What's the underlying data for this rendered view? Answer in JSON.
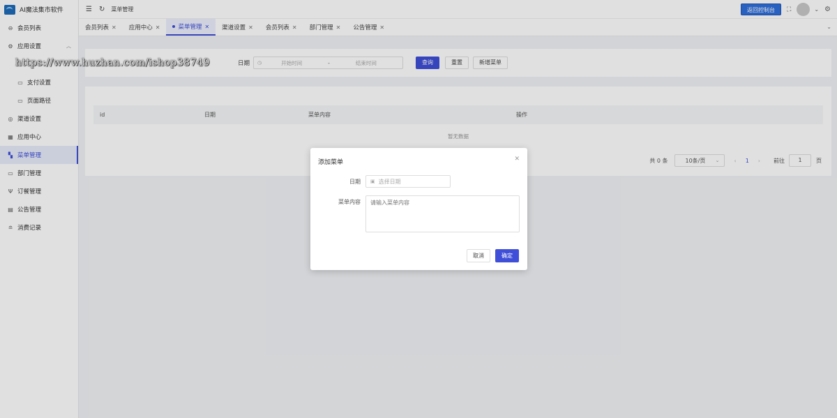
{
  "app": {
    "name": "AI魔法集市软件",
    "accent": "#3f4fd8"
  },
  "sidebar": {
    "items": [
      {
        "label": "会员列表",
        "icon": "user-circle-icon"
      },
      {
        "label": "应用设置",
        "icon": "gear-icon",
        "expanded": true
      },
      {
        "label": "支付设置",
        "icon": "folder-icon"
      },
      {
        "label": "页面路径",
        "icon": "folder-icon"
      },
      {
        "label": "渠道设置",
        "icon": "compass-icon"
      },
      {
        "label": "应用中心",
        "icon": "grid-icon"
      },
      {
        "label": "菜单管理",
        "icon": "grid-icon",
        "active": true
      },
      {
        "label": "部门管理",
        "icon": "folder-icon"
      },
      {
        "label": "订餐管理",
        "icon": "fork-knife-icon"
      },
      {
        "label": "公告管理",
        "icon": "document-icon"
      },
      {
        "label": "消费记录",
        "icon": "database-icon"
      }
    ]
  },
  "header": {
    "breadcrumb": "菜单管理",
    "console_button": "返回控制台"
  },
  "tabs": [
    {
      "label": "会员列表"
    },
    {
      "label": "应用中心"
    },
    {
      "label": "菜单管理",
      "active": true
    },
    {
      "label": "渠道设置"
    },
    {
      "label": "会员列表"
    },
    {
      "label": "部门管理"
    },
    {
      "label": "公告管理"
    }
  ],
  "search": {
    "date_label": "日期",
    "start_placeholder": "开始时间",
    "separator": "-",
    "end_placeholder": "结束时间",
    "query_button": "查询",
    "reset_button": "重置",
    "add_button": "新增菜单"
  },
  "table": {
    "columns": [
      "id",
      "日期",
      "菜单内容",
      "操作"
    ],
    "empty_text": "暂无数据"
  },
  "pagination": {
    "total": "共 0 条",
    "page_size": "10条/页",
    "current_page": "1",
    "goto_label": "前往",
    "goto_value": "1",
    "goto_unit": "页"
  },
  "modal": {
    "title": "添加菜单",
    "date_label": "日期",
    "date_placeholder": "选择日期",
    "content_label": "菜单内容",
    "content_placeholder": "请输入菜单内容",
    "cancel_button": "取消",
    "confirm_button": "确定"
  },
  "watermark": "https://www.huzhan.com/ishop38749"
}
